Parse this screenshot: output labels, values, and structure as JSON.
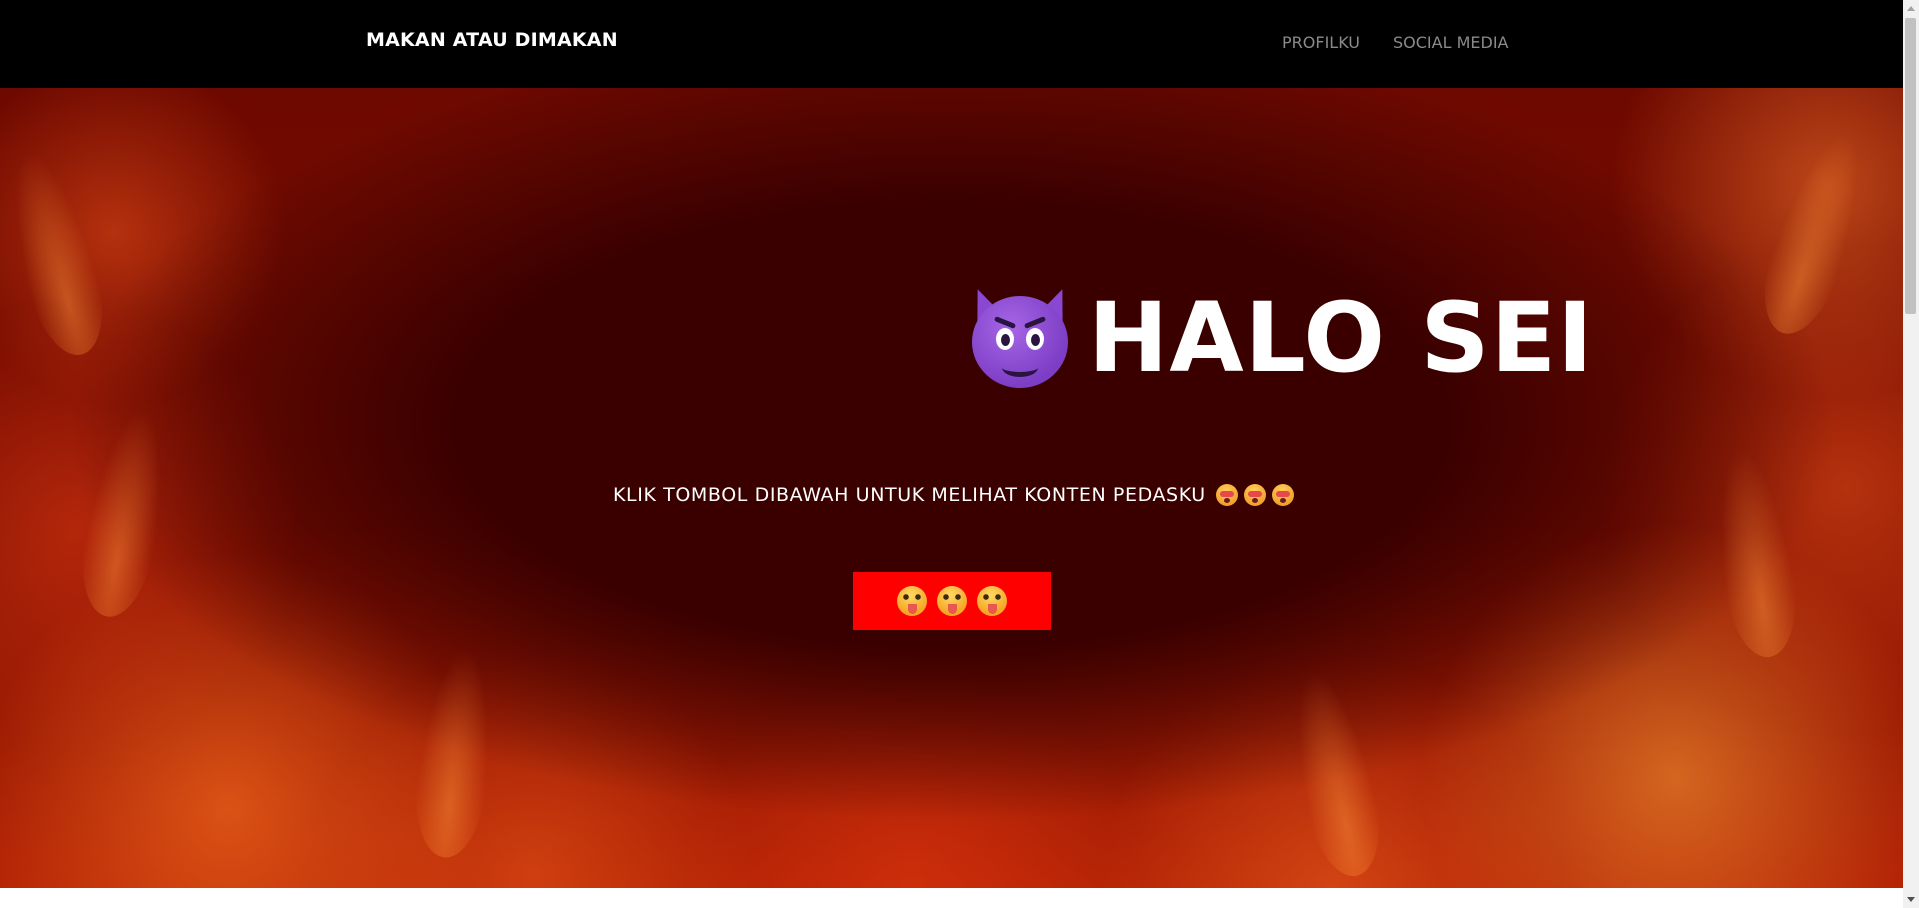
{
  "navbar": {
    "brand": "MAKAN ATAU DIMAKAN",
    "links": [
      {
        "label": "PROFILKU"
      },
      {
        "label": "SOCIAL MEDIA"
      }
    ]
  },
  "hero": {
    "title": "HALO SEI",
    "title_icon": "smiling-face-with-horns-icon",
    "subtitle": "KLIK TOMBOL DIBAWAH UNTUK MELIHAT KONTEN PEDASKU",
    "subtitle_icons": [
      "flushed-face-icon",
      "flushed-face-icon",
      "flushed-face-icon"
    ],
    "button_icons": [
      "drooling-face-icon",
      "drooling-face-icon",
      "drooling-face-icon"
    ]
  },
  "colors": {
    "navbar_bg": "#000000",
    "hero_bg": "#3a0000",
    "button_bg": "#ff0000",
    "nav_link": "#8a8a8a",
    "text": "#ffffff"
  }
}
